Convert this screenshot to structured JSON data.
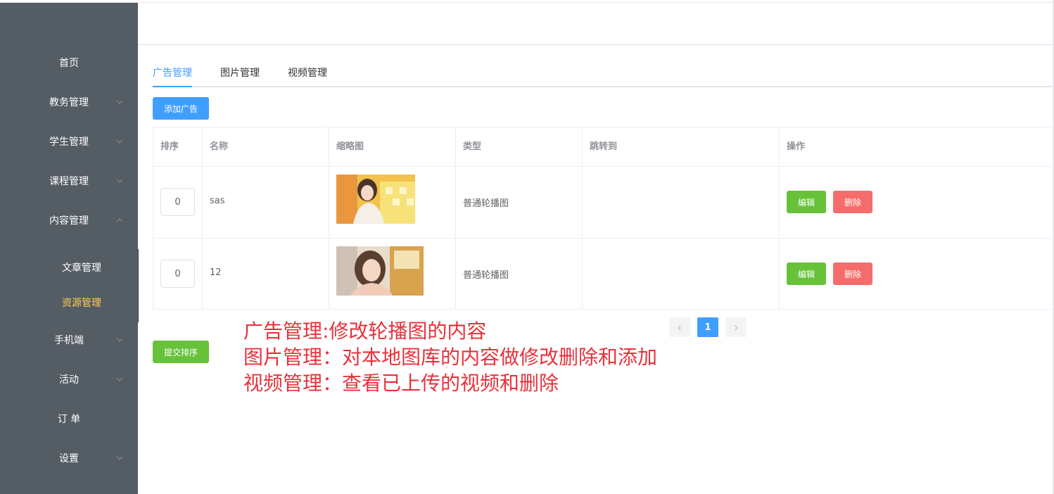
{
  "sidebar": {
    "items": [
      {
        "label": "首页"
      },
      {
        "label": "教务管理"
      },
      {
        "label": "学生管理"
      },
      {
        "label": "课程管理"
      },
      {
        "label": "内容管理"
      },
      {
        "label": "手机端"
      },
      {
        "label": "活动"
      },
      {
        "label": "订 单"
      },
      {
        "label": "设置"
      }
    ],
    "sub_items": [
      {
        "label": "文章管理"
      },
      {
        "label": "资源管理"
      }
    ],
    "active_color": "#ffd04b"
  },
  "tabs": [
    {
      "label": "广告管理"
    },
    {
      "label": "图片管理"
    },
    {
      "label": "视频管理"
    }
  ],
  "toolbar": {
    "add_label": "添加广告",
    "submit_sort_label": "提交排序"
  },
  "table": {
    "headers": [
      "排序",
      "名称",
      "缩略图",
      "类型",
      "跳转到",
      "操作"
    ],
    "rows": [
      {
        "sort": "0",
        "name": "sas",
        "type": "普通轮播图",
        "jump": ""
      },
      {
        "sort": "0",
        "name": "12",
        "type": "普通轮播图",
        "jump": ""
      }
    ],
    "edit_label": "编辑",
    "delete_label": "删除"
  },
  "pagination": {
    "current": "1"
  },
  "annotation": {
    "lines": [
      "广告管理:修改轮播图的内容",
      "图片管理：对本地图库的内容做修改删除和添加",
      "视频管理：查看已上传的视频和删除"
    ],
    "color": "#e8313b"
  },
  "colors": {
    "sidebar_bg": "#545c64",
    "primary": "#409eff",
    "success": "#67c23a",
    "danger": "#f56c6c"
  }
}
